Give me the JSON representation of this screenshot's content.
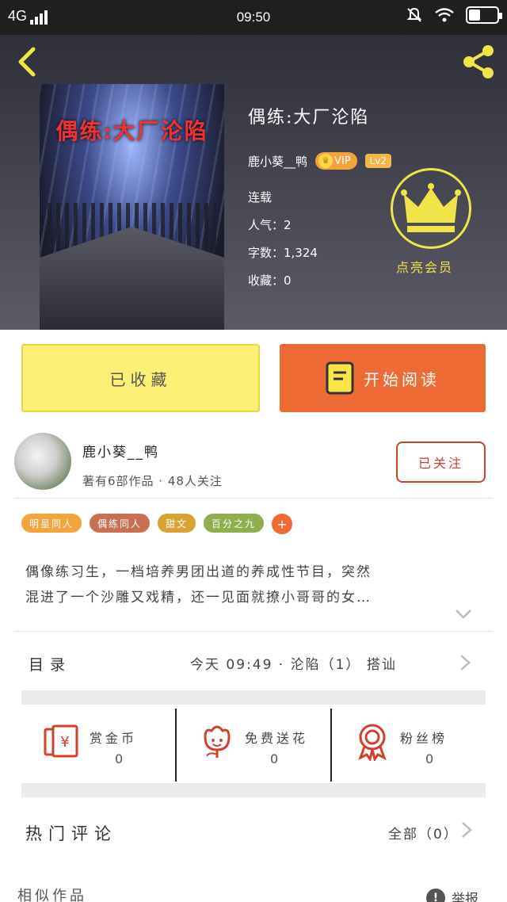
{
  "status_bar": {
    "network": "4G",
    "time": "09:50"
  },
  "book": {
    "title": "偶练:大厂沦陷",
    "cover_text": "偶练:大厂沦陷",
    "author": "鹿小葵__鸭",
    "vip": "VIP",
    "level": "Lv2",
    "status": "连载",
    "popularity": "人气：2",
    "word_count": "字数：1,324",
    "favorites": "收藏：0",
    "member_label": "点亮会员"
  },
  "actions": {
    "collected": "已收藏",
    "start_reading": "开始阅读"
  },
  "author_card": {
    "name": "鹿小葵__鸭",
    "meta": "著有6部作品 · 48人关注",
    "follow": "已关注"
  },
  "tags": [
    {
      "label": "明星同人",
      "color": "#f3a53c"
    },
    {
      "label": "偶练同人",
      "color": "#c96f54"
    },
    {
      "label": "甜文",
      "color": "#d7a335"
    },
    {
      "label": "百分之九",
      "color": "#8fae4f"
    }
  ],
  "tag_add": "+",
  "description": [
    "偶像练习生，一档培养男团出道的养成性节目，突然",
    "混进了一个沙雕又戏精，还一见面就撩小哥哥的女…"
  ],
  "catalog": {
    "label": "目录",
    "latest": "今天 09:49 · 沦陷（1） 搭讪"
  },
  "stats": [
    {
      "name": "赏金币",
      "value": "0",
      "icon": "reward-coin-icon"
    },
    {
      "name": "免费送花",
      "value": "0",
      "icon": "flower-icon"
    },
    {
      "name": "粉丝榜",
      "value": "0",
      "icon": "medal-icon"
    }
  ],
  "hot_comments": {
    "label": "热门评论",
    "all": "全部（0）"
  },
  "bottom": {
    "similar": "相似作品",
    "report": "举报",
    "report_icon": "!"
  },
  "colors": {
    "accent_orange": "#ef6b35",
    "collected_yellow": "#fbf075",
    "crown_yellow": "#f1e34a",
    "follow_red": "#c9402e"
  }
}
